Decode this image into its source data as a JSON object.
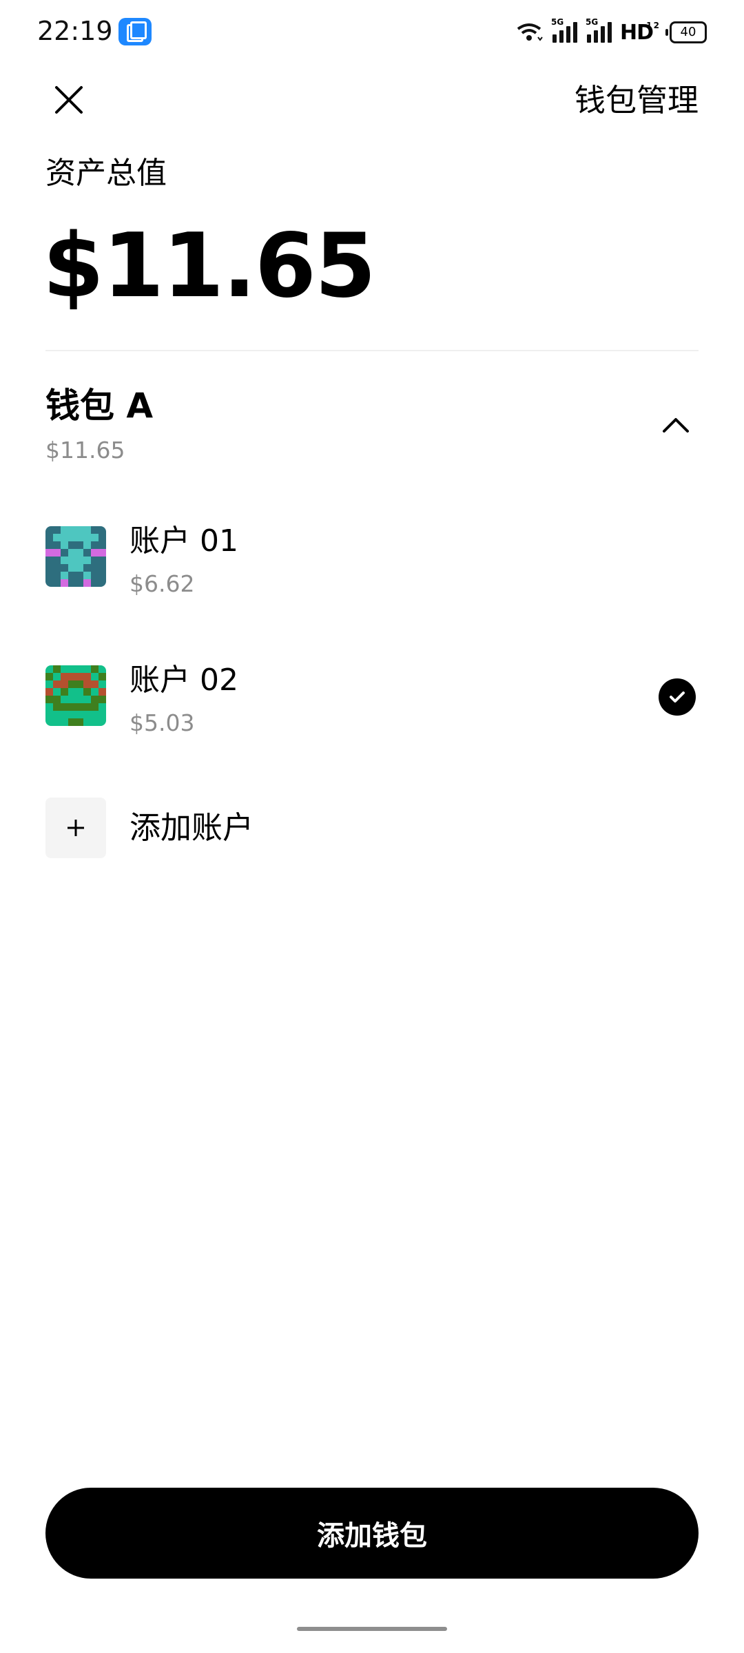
{
  "status_bar": {
    "time": "22:19",
    "signal1_tag": "5G",
    "signal2_tag": "5G",
    "hd_label": "HD",
    "hd_sub": "1 2",
    "battery_level": "40"
  },
  "header": {
    "close_icon": "close-icon",
    "title": "钱包管理"
  },
  "summary": {
    "label": "资产总值",
    "total": "$11.65"
  },
  "wallet": {
    "name": "钱包 A",
    "value": "$11.65",
    "expanded": true,
    "accounts": [
      {
        "name": "账户 01",
        "value": "$6.62",
        "selected": false
      },
      {
        "name": "账户 02",
        "value": "$5.03",
        "selected": true
      }
    ],
    "add_account_label": "添加账户"
  },
  "footer": {
    "add_wallet_label": "添加钱包"
  },
  "colors": {
    "accent": "#000000",
    "secondary_text": "#8c8c8c",
    "app_badge": "#1E88FF"
  }
}
